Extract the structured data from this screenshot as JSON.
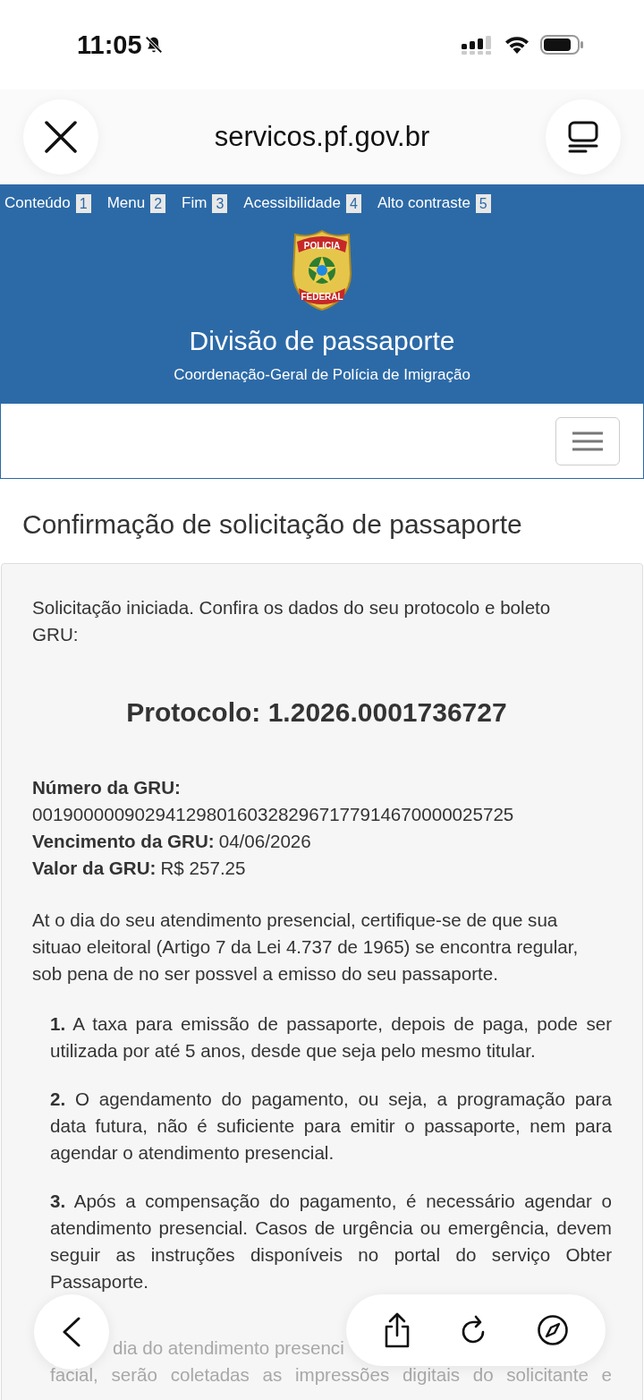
{
  "status_bar": {
    "time": "11:05"
  },
  "browser": {
    "url": "servicos.pf.gov.br"
  },
  "skip_links": [
    {
      "label": "Conteúdo",
      "key": "1"
    },
    {
      "label": "Menu",
      "key": "2"
    },
    {
      "label": "Fim",
      "key": "3"
    },
    {
      "label": "Acessibilidade",
      "key": "4"
    },
    {
      "label": "Alto contraste",
      "key": "5"
    }
  ],
  "header": {
    "logo_top": "POLICIA",
    "logo_bottom": "FEDERAL",
    "title": "Divisão de passaporte",
    "subtitle": "Coordenação-Geral de Polícia de Imigração"
  },
  "page_title": "Confirmação de solicitação de passaporte",
  "card": {
    "intro": "Solicitação iniciada. Confira os dados do seu protocolo e boleto GRU:",
    "protocol": "Protocolo: 1.2026.0001736727",
    "fields": [
      {
        "label": "Número da GRU:",
        "value": "00190000090294129801603282967177914670000025725",
        "block": true
      },
      {
        "label": "Vencimento da GRU:",
        "value": "04/06/2026",
        "block": false
      },
      {
        "label": "Valor da GRU:",
        "value": "R$ 257.25",
        "block": false
      }
    ],
    "notice": "At o dia do seu atendimento presencial, certifique-se de que sua situao eleitoral (Artigo 7 da Lei 4.737 de 1965) se encontra regular, sob pena de no ser possvel a emisso do seu passaporte.",
    "items": [
      {
        "number": "1.",
        "text": "A taxa para emissão de passaporte, depois de paga, pode ser utilizada por até 5 anos, desde que seja pelo mesmo titular."
      },
      {
        "number": "2.",
        "text": "O agendamento do pagamento, ou seja, a programação para data futura, não é suficiente para emitir o passaporte, nem para agendar o atendimento presencial."
      },
      {
        "number": "3.",
        "text": "Após a compensação do pagamento, é necessário agendar o atendimento presencial. Casos de urgência ou emergência, devem seguir as instruções disponíveis no portal do serviço Obter Passaporte."
      }
    ],
    "partial_item": {
      "fragment_left": "dia do atendimento presenci",
      "line": "facial, serão coletadas as impressões digitais do solicitante e"
    }
  }
}
